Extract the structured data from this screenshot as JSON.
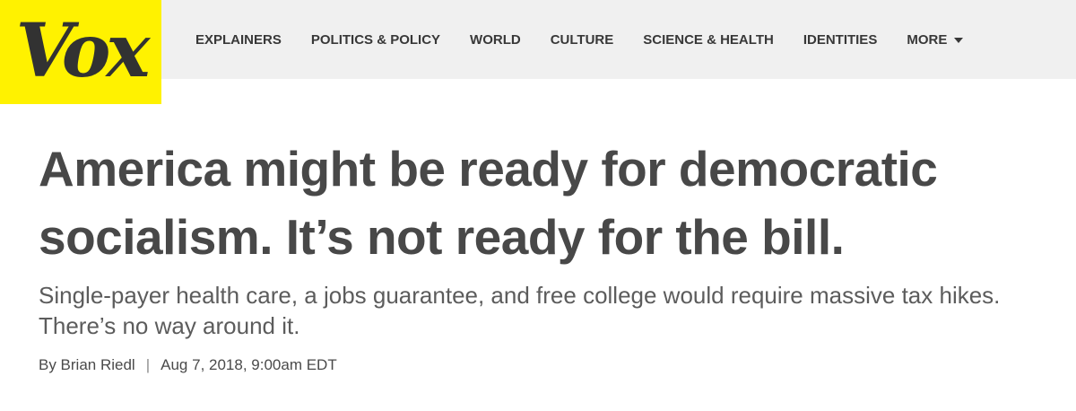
{
  "header": {
    "logo_text": "Vox",
    "nav": [
      {
        "label": "EXPLAINERS"
      },
      {
        "label": "POLITICS & POLICY"
      },
      {
        "label": "WORLD"
      },
      {
        "label": "CULTURE"
      },
      {
        "label": "SCIENCE & HEALTH"
      },
      {
        "label": "IDENTITIES"
      },
      {
        "label": "MORE"
      }
    ],
    "more_icon": "chevron-down-icon"
  },
  "colors": {
    "logo_background": "#fff200",
    "nav_background": "#f0f0f0",
    "headline_text": "#484848"
  },
  "article": {
    "headline": "America might be ready for democratic socialism. It’s not ready for the bill.",
    "dek": "Single-payer health care, a jobs guarantee, and free college would require massive tax hikes. There’s no way around it.",
    "byline": {
      "author": "By Brian Riedl",
      "separator": "|",
      "date": "Aug 7, 2018, 9:00am EDT"
    }
  }
}
